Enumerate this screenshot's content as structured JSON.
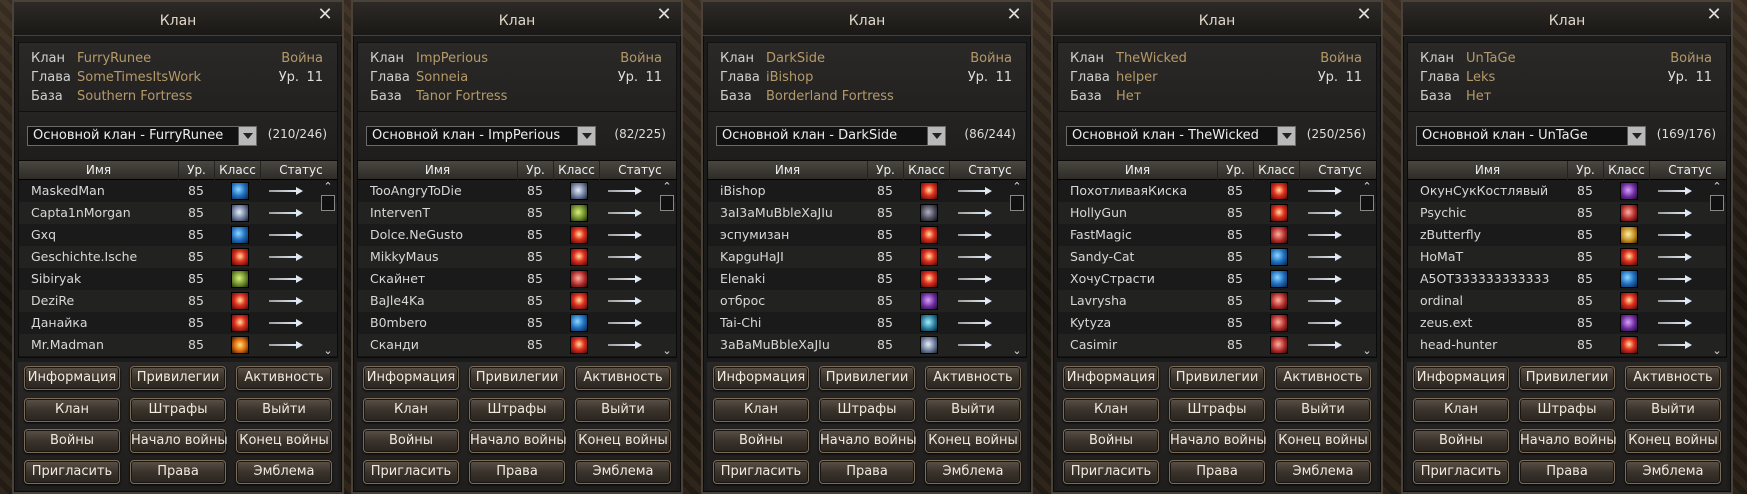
{
  "labels": {
    "title": "Клан",
    "clan": "Клан",
    "leader": "Глава",
    "base": "База",
    "war": "Война",
    "level": "Ур.",
    "col_name": "Имя",
    "col_level": "Ур.",
    "col_class": "Класс",
    "col_status": "Статус"
  },
  "buttons": [
    "Информация",
    "Привилегии",
    "Активность",
    "Клан",
    "Штрафы",
    "Выйти",
    "Войны",
    "Начало войны",
    "Конец войны",
    "Пригласить",
    "Права",
    "Эмблема"
  ],
  "panels": [
    {
      "clan": "FurryRunee",
      "leader": "SomeTimesItsWork",
      "base": "Southern Fortress",
      "level": "11",
      "select": "Основной клан - FurryRunee",
      "count": "(210/246)",
      "members": [
        {
          "name": "MaskedMan",
          "level": "85",
          "icon": "ic-blue"
        },
        {
          "name": "Capta1nMorgan",
          "level": "85",
          "icon": "ic-steel"
        },
        {
          "name": "Gxq",
          "level": "85",
          "icon": "ic-blue"
        },
        {
          "name": "Geschichte.Ische",
          "level": "85",
          "icon": "ic-red"
        },
        {
          "name": "Sibiryak",
          "level": "85",
          "icon": "ic-green"
        },
        {
          "name": "DeziRe",
          "level": "85",
          "icon": "ic-red"
        },
        {
          "name": "Данайка",
          "level": "85",
          "icon": "ic-red"
        },
        {
          "name": "Mr.Madman",
          "level": "85",
          "icon": "ic-orange"
        }
      ]
    },
    {
      "clan": "ImpPerious",
      "leader": "Sonneia",
      "base": "Tanor Fortress",
      "level": "11",
      "select": "Основной клан - ImpPerious",
      "count": "(82/225)",
      "members": [
        {
          "name": "TooAngryToDie",
          "level": "85",
          "icon": "ic-steel"
        },
        {
          "name": "IntervenT",
          "level": "85",
          "icon": "ic-green"
        },
        {
          "name": "Dolce.NeGusto",
          "level": "85",
          "icon": "ic-red"
        },
        {
          "name": "MikkyMaus",
          "level": "85",
          "icon": "ic-red"
        },
        {
          "name": "Скайнет",
          "level": "85",
          "icon": "ic-rose"
        },
        {
          "name": "BaJle4Ka",
          "level": "85",
          "icon": "ic-red"
        },
        {
          "name": "B0mbero",
          "level": "85",
          "icon": "ic-blue"
        },
        {
          "name": "Сканди",
          "level": "85",
          "icon": "ic-red"
        }
      ]
    },
    {
      "clan": "DarkSide",
      "leader": "iBishop",
      "base": "Borderland Fortress",
      "level": "11",
      "select": "Основной клан - DarkSide",
      "count": "(86/244)",
      "members": [
        {
          "name": "iBishop",
          "level": "85",
          "icon": "ic-red"
        },
        {
          "name": "3aI3aMuBbleXaJIu",
          "level": "85",
          "icon": "ic-dark"
        },
        {
          "name": "эспумизан",
          "level": "85",
          "icon": "ic-red"
        },
        {
          "name": "KapguHaJI",
          "level": "85",
          "icon": "ic-red"
        },
        {
          "name": "Elenaki",
          "level": "85",
          "icon": "ic-red"
        },
        {
          "name": "отброс",
          "level": "85",
          "icon": "ic-purple"
        },
        {
          "name": "Tai-Chi",
          "level": "85",
          "icon": "ic-teal"
        },
        {
          "name": "3aBaMuBbleXaJIu",
          "level": "85",
          "icon": "ic-steel"
        }
      ]
    },
    {
      "clan": "TheWicked",
      "leader": "helper",
      "base": "Нет",
      "level": "11",
      "select": "Основной клан - TheWicked",
      "count": "(250/256)",
      "members": [
        {
          "name": "ПохотливаяКиска",
          "level": "85",
          "icon": "ic-red"
        },
        {
          "name": "HollyGun",
          "level": "85",
          "icon": "ic-red"
        },
        {
          "name": "FastMagic",
          "level": "85",
          "icon": "ic-rose"
        },
        {
          "name": "Sandy-Cat",
          "level": "85",
          "icon": "ic-blue"
        },
        {
          "name": "ХочуСтрасти",
          "level": "85",
          "icon": "ic-blue"
        },
        {
          "name": "Lavrysha",
          "level": "85",
          "icon": "ic-rose"
        },
        {
          "name": "Kytyza",
          "level": "85",
          "icon": "ic-rose"
        },
        {
          "name": "Casimir",
          "level": "85",
          "icon": "ic-rose"
        }
      ]
    },
    {
      "clan": "UnTaGe",
      "leader": "Leks",
      "base": "Нет",
      "level": "11",
      "select": "Основной клан - UnTaGe",
      "count": "(169/176)",
      "members": [
        {
          "name": "ОкунСукКостлявый",
          "level": "85",
          "icon": "ic-purple"
        },
        {
          "name": "Psychic",
          "level": "85",
          "icon": "ic-rose"
        },
        {
          "name": "zButterfly",
          "level": "85",
          "icon": "ic-gold"
        },
        {
          "name": "HoMaT",
          "level": "85",
          "icon": "ic-red"
        },
        {
          "name": "A5OT333333333333",
          "level": "85",
          "icon": "ic-blue"
        },
        {
          "name": "ordinal",
          "level": "85",
          "icon": "ic-red"
        },
        {
          "name": "zeus.ext",
          "level": "85",
          "icon": "ic-purple"
        },
        {
          "name": "head-hunter",
          "level": "85",
          "icon": "ic-red"
        }
      ]
    }
  ]
}
